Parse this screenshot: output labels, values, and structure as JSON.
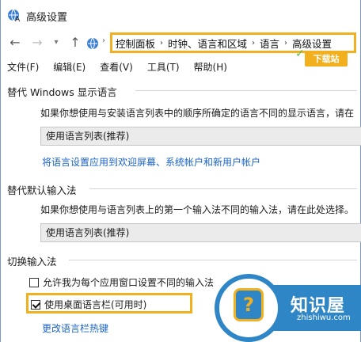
{
  "window": {
    "title": "高级设置"
  },
  "nav": {
    "back": "←",
    "forward": "→",
    "dropdown": "▾",
    "up": "↑",
    "breadcrumbs": [
      "控制面板",
      "时钟、语言和区域",
      "语言",
      "高级设置"
    ],
    "separator": "›"
  },
  "watermark": {
    "badge": "下载站"
  },
  "menu": {
    "items": [
      "文件(F)",
      "编辑(E)",
      "查看(V)",
      "工具(T)",
      "帮助(H)"
    ]
  },
  "display_language": {
    "title": "替代 Windows 显示语言",
    "description": "如果你想使用与安装语言列表中的顺序所确定的语言不同的显示语言，请在",
    "select_value": "使用语言列表(推荐)",
    "link": "将语言设置应用到欢迎屏幕、系统帐户和新用户帐户"
  },
  "input_method": {
    "title": "替代默认输入法",
    "description": "如果你想使用与语言列表上的第一个输入法不同的输入法，请在此处选择。",
    "select_value": "使用语言列表(推荐)"
  },
  "switch_input": {
    "title": "切换输入法",
    "option_per_app": "允许我为每个应用窗口设置不同的输入法",
    "option_per_app_checked": false,
    "option_desktop_bar": "使用桌面语言栏(可用时)",
    "option_desktop_bar_checked": true,
    "link_hotkeys": "更改语言栏热键"
  },
  "logo": {
    "title": "知识屋",
    "subtitle": "zhishiwu.com",
    "mark": "?"
  },
  "colors": {
    "highlight": "#f2b01e",
    "link": "#1a63c7",
    "logo_blue": "#2f86c6"
  }
}
